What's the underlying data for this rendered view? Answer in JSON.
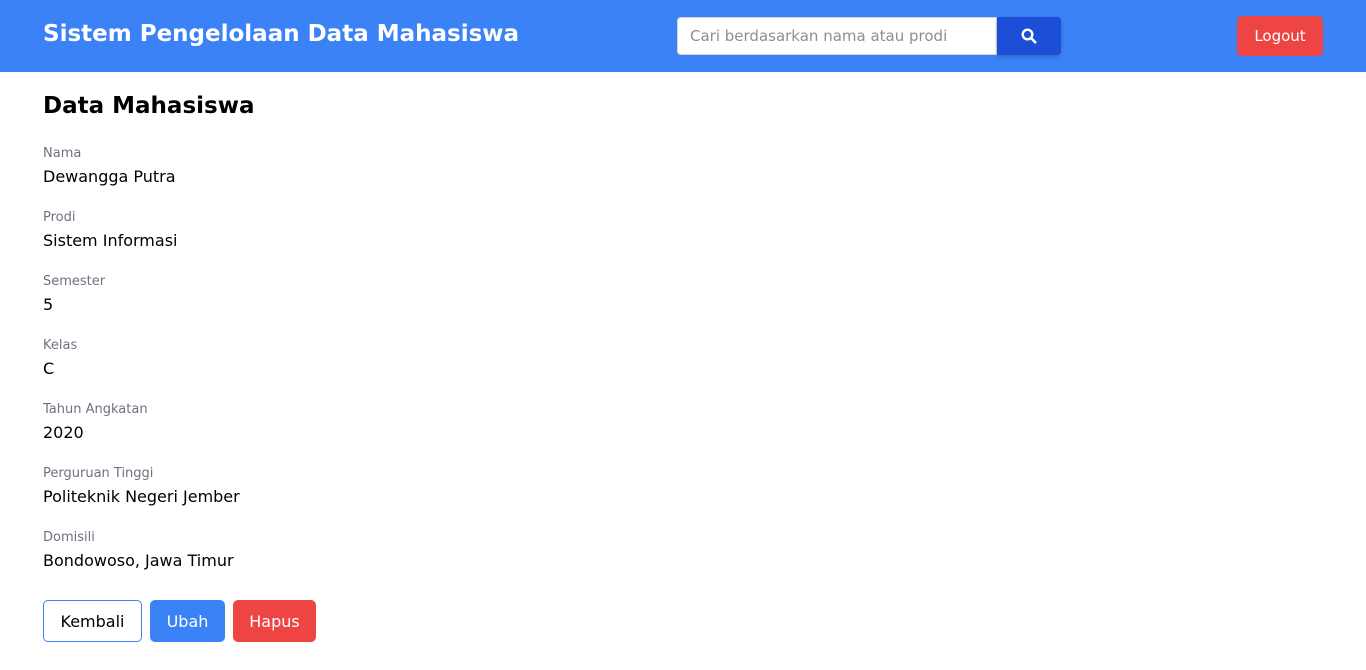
{
  "navbar": {
    "brand": "Sistem Pengelolaan Data Mahasiswa",
    "search_placeholder": "Cari berdasarkan nama atau prodi",
    "search_icon": "search-icon",
    "logout_label": "Logout",
    "bg_color": "#3b82f6"
  },
  "main": {
    "title": "Data Mahasiswa",
    "fields": [
      {
        "label": "Nama",
        "value": "Dewangga Putra"
      },
      {
        "label": "Prodi",
        "value": "Sistem Informasi"
      },
      {
        "label": "Semester",
        "value": "5"
      },
      {
        "label": "Kelas",
        "value": "C"
      },
      {
        "label": "Tahun Angkatan",
        "value": "2020"
      },
      {
        "label": "Perguruan Tinggi",
        "value": "Politeknik Negeri Jember"
      },
      {
        "label": "Domisili",
        "value": "Bondowoso, Jawa Timur"
      }
    ],
    "actions": {
      "back_label": "Kembali",
      "edit_label": "Ubah",
      "delete_label": "Hapus"
    }
  },
  "colors": {
    "primary": "#3b82f6",
    "primary_dark": "#1d4ed8",
    "danger": "#ef4444"
  }
}
